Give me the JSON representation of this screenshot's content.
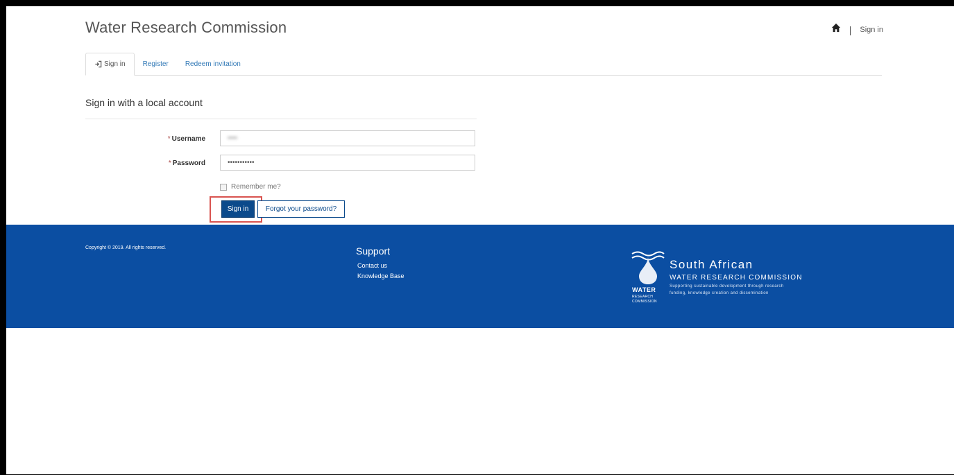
{
  "header": {
    "brand": "Water Research Commission",
    "nav_signin": "Sign in",
    "home_icon": "home-icon"
  },
  "tabs": [
    {
      "label": "Sign in",
      "icon": "signin-icon",
      "active": true
    },
    {
      "label": "Register",
      "active": false
    },
    {
      "label": "Redeem invitation",
      "active": false
    }
  ],
  "form": {
    "title": "Sign in with a local account",
    "username_label": "Username",
    "username_value": "••••",
    "password_label": "Password",
    "password_value": "•••••••••••",
    "required_marker": "*",
    "remember_label": "Remember me?",
    "signin_button": "Sign in",
    "forgot_button": "Forgot your password?"
  },
  "footer": {
    "copyright": "Copyright © 2019. All rights reserved.",
    "support_title": "Support",
    "links": [
      "Contact us",
      "Knowledge Base"
    ],
    "logo": {
      "title": "South African",
      "subtitle": "WATER RESEARCH COMMISSION",
      "tagline_1": "Supporting sustainable development through research",
      "tagline_2": "funding, knowledge creation and dissemination",
      "mark_water": "WATER",
      "mark_research": "RESEARCH",
      "mark_commission": "COMMISSION"
    }
  },
  "colors": {
    "primary": "#0b4a8b",
    "footer": "#0b4ea2",
    "highlight": "#d9534f"
  }
}
